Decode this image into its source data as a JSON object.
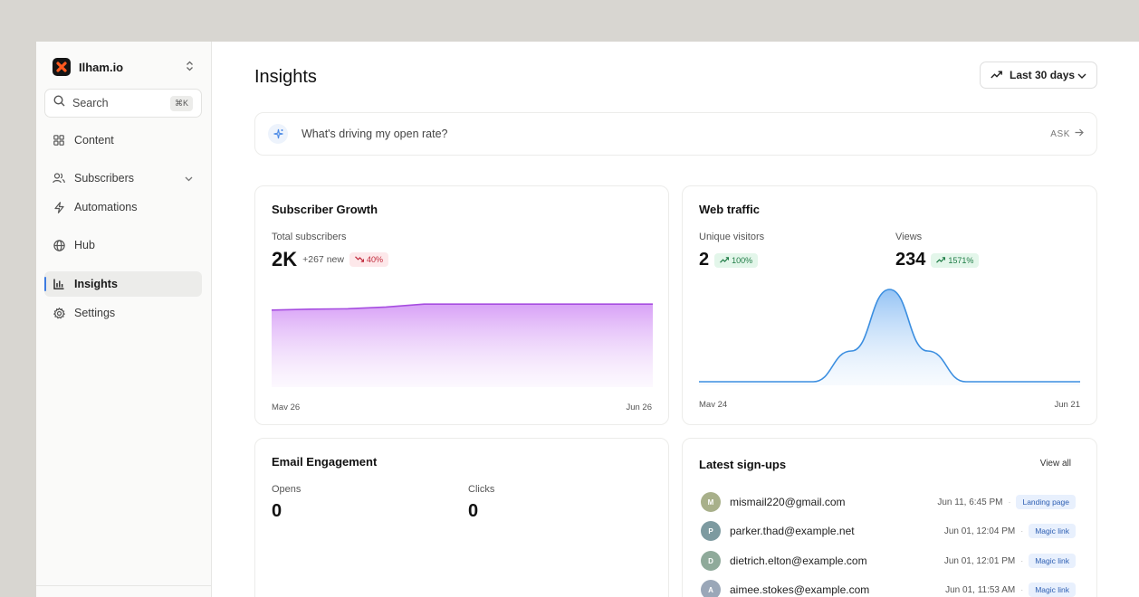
{
  "sidebar": {
    "brand": "Ilham.io",
    "search": {
      "label": "Search",
      "shortcut": "⌘K"
    },
    "items": [
      {
        "label": "Content",
        "icon": "grid-icon"
      },
      {
        "label": "Subscribers",
        "icon": "users-icon"
      },
      {
        "label": "Automations",
        "icon": "bolt-icon"
      },
      {
        "label": "Hub",
        "icon": "globe-icon"
      },
      {
        "label": "Insights",
        "icon": "bar-chart-icon",
        "active": true
      },
      {
        "label": "Settings",
        "icon": "gear-icon"
      }
    ]
  },
  "header": {
    "title": "Insights",
    "range_label": "Last 30 days"
  },
  "ask": {
    "question": "What's driving my open rate?",
    "cta": "ASK"
  },
  "subscriber_growth": {
    "title": "Subscriber Growth",
    "stat_label": "Total subscribers",
    "value": "2K",
    "new": "+267 new",
    "change": "40%",
    "x_start": "Mav 26",
    "x_end": "Jun 26"
  },
  "web_traffic": {
    "title": "Web traffic",
    "unique_label": "Unique visitors",
    "unique_value": "2",
    "unique_change": "100%",
    "views_label": "Views",
    "views_value": "234",
    "views_change": "1571%",
    "x_start": "Mav 24",
    "x_end": "Jun 21"
  },
  "email_engagement": {
    "title": "Email Engagement",
    "opens_label": "Opens",
    "opens_value": "0",
    "clicks_label": "Clicks",
    "clicks_value": "0"
  },
  "signups": {
    "title": "Latest sign-ups",
    "view_all": "View all",
    "rows": [
      {
        "initial": "M",
        "email": "mismail220@gmail.com",
        "time": "Jun 11, 6:45 PM",
        "source": "Landing page"
      },
      {
        "initial": "P",
        "email": "parker.thad@example.net",
        "time": "Jun 01, 12:04 PM",
        "source": "Magic link"
      },
      {
        "initial": "D",
        "email": "dietrich.elton@example.com",
        "time": "Jun 01, 12:01 PM",
        "source": "Magic link"
      },
      {
        "initial": "A",
        "email": "aimee.stokes@example.com",
        "time": "Jun 01, 11:53 AM",
        "source": "Magic link"
      }
    ]
  },
  "chart_data": [
    {
      "type": "area",
      "title": "Subscriber Growth",
      "x": [
        "Mav 26",
        "Jun 26"
      ],
      "series": [
        {
          "values": [
            1.73,
            1.75,
            1.76,
            1.8,
            1.87,
            1.87,
            1.87,
            1.87,
            1.87,
            1.87,
            1.87
          ]
        }
      ],
      "color": "#a64de0"
    },
    {
      "type": "area",
      "title": "Web traffic",
      "x": [
        "Mav 24",
        "Jun 21"
      ],
      "series": [
        {
          "values": [
            0,
            0,
            0,
            0,
            1,
            3,
            1,
            0,
            0,
            0,
            0
          ]
        }
      ],
      "color": "#3b8ee0"
    }
  ]
}
